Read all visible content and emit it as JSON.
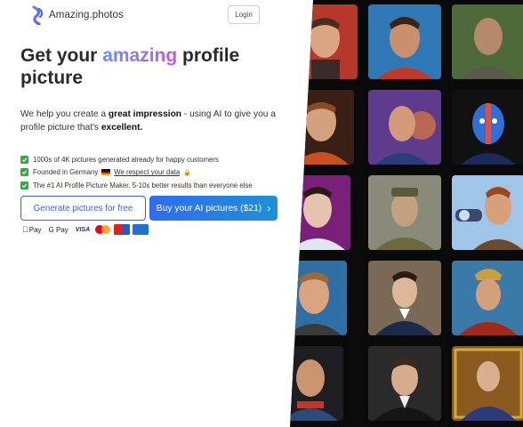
{
  "brand": {
    "name": "Amazing.photos"
  },
  "header": {
    "login_label": "Login"
  },
  "hero": {
    "title_part1": "Get your ",
    "title_accent": "amazing",
    "title_part2": " profile picture",
    "sub_part1": "We help you create a ",
    "sub_bold1": "great impression",
    "sub_part2": " - using AI to give you a profile picture that's ",
    "sub_bold2": "excellent."
  },
  "features": {
    "item1": "1000s of 4K pictures generated already for happy customers",
    "item2_prefix": "Founded in Germany",
    "item2_link": "We respect your data",
    "item3": "The #1 AI Profile Picture Maker. 5-10x better results than everyone else"
  },
  "cta": {
    "secondary_label": "Generate pictures for free",
    "primary_label": "Buy your AI pictures ($21)"
  },
  "payments": {
    "apple": "Pay",
    "google": "G Pay",
    "visa": "VISA"
  },
  "gallery_count": 15,
  "colors": {
    "accent_start": "#6b8df0",
    "accent_end": "#c45ae0",
    "primary_button": "#2f6df0",
    "check_green": "#2eac3d"
  }
}
